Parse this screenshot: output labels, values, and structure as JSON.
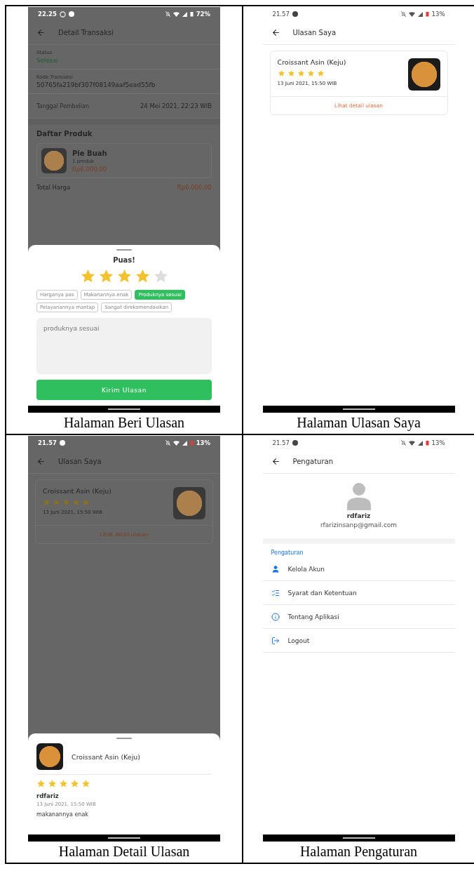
{
  "panels": [
    {
      "kind": "transaction_review",
      "caption": "Halaman Beri Ulasan",
      "dimmed": true,
      "status_bar": {
        "time": "22.25",
        "battery": "72%",
        "battery_low": false,
        "chat_notification": true
      },
      "app_bar": {
        "title": "Detail Transaksi"
      },
      "fields": [
        {
          "label": "Status",
          "value": "Selesai",
          "kind": "status"
        },
        {
          "label": "Kode Transaksi",
          "value": "50765fa219bf307f08149aaf5ead55fb",
          "kind": "plain"
        }
      ],
      "purchase_date": {
        "label": "Tanggal Pembelian",
        "value": "24 Mei 2021, 22:23 WIB"
      },
      "products_title": "Daftar Produk",
      "product": {
        "name": "Pie Buah",
        "quantity": "1 produk",
        "price": "Rp6.000,00"
      },
      "total": {
        "label": "Total Harga",
        "value": "Rp6.000,00"
      },
      "sheet": {
        "title": "Puas!",
        "stars": 4,
        "tags": [
          {
            "label": "Harganya pas",
            "selected": false
          },
          {
            "label": "Makanannya enak",
            "selected": false
          },
          {
            "label": "Produknya sesuai",
            "selected": true
          },
          {
            "label": "Pelayanannya mantap",
            "selected": false
          },
          {
            "label": "Sangat direkomendasikan",
            "selected": false
          }
        ],
        "comment": "produknya sesuai",
        "button": "Kirim Ulasan"
      }
    },
    {
      "kind": "review_list",
      "caption": "Halaman Ulasan Saya",
      "dimmed": false,
      "status_bar": {
        "time": "21.57",
        "battery": "13%",
        "battery_low": true,
        "chat_notification": false
      },
      "app_bar": {
        "title": "Ulasan Saya"
      },
      "reviews": [
        {
          "product": "Croissant Asin (Keju)",
          "stars": 5,
          "date": "13 Juni 2021, 15:50 WIB",
          "link": "Lihat detail ulasan"
        }
      ]
    },
    {
      "kind": "review_detail",
      "caption": "Halaman Detail Ulasan",
      "dimmed": true,
      "status_bar": {
        "time": "21.57",
        "battery": "13%",
        "battery_low": true,
        "chat_notification": false
      },
      "app_bar": {
        "title": "Ulasan Saya"
      },
      "reviews": [
        {
          "product": "Croissant Asin (Keju)",
          "stars": 5,
          "date": "13 Juni 2021, 15:50 WIB",
          "link": "Lihat detail ulasan"
        }
      ],
      "sheet": {
        "product": "Croissant Asin (Keju)",
        "stars": 5,
        "user": "rdfariz",
        "date": "13 Juni 2021, 15:50 WIB",
        "comment": "makanannya enak"
      }
    },
    {
      "kind": "settings",
      "caption": "Halaman Pengaturan",
      "dimmed": false,
      "status_bar": {
        "time": "21.57",
        "battery": "13%",
        "battery_low": true,
        "chat_notification": false
      },
      "app_bar": {
        "title": "Pengaturan"
      },
      "profile": {
        "name": "rdfariz",
        "email": "rfarizinsanp@gmail.com"
      },
      "section_title": "Pengaturan",
      "items": [
        {
          "label": "Kelola Akun",
          "kind": "account"
        },
        {
          "label": "Syarat dan Ketentuan",
          "kind": "terms"
        },
        {
          "label": "Tentang Aplikasi",
          "kind": "about"
        },
        {
          "label": "Logout",
          "kind": "logout"
        }
      ]
    }
  ]
}
